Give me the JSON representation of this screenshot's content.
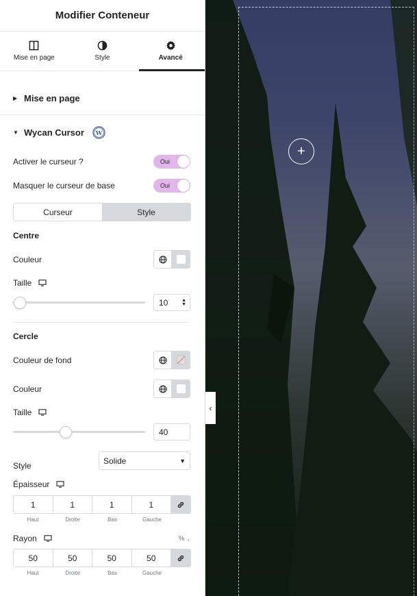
{
  "header": {
    "title": "Modifier Conteneur"
  },
  "tabs": [
    {
      "label": "Mise en page",
      "icon": "layout-columns-icon"
    },
    {
      "label": "Style",
      "icon": "half-circle-icon"
    },
    {
      "label": "Avancé",
      "icon": "gear-icon",
      "active": true
    }
  ],
  "sections": {
    "layout": {
      "title": "Mise en page",
      "expanded": false
    },
    "cursor": {
      "title": "Wycan Cursor",
      "expanded": true,
      "logo": "wordpress-icon"
    }
  },
  "cursor": {
    "activate": {
      "label": "Activer le curseur ?",
      "value": "Oui"
    },
    "hide_base": {
      "label": "Masquer le curseur de base",
      "value": "Oui"
    },
    "switcher": {
      "left": "Curseur",
      "right": "Style",
      "selected": "Style"
    },
    "centre": {
      "heading": "Centre",
      "color_label": "Couleur",
      "size_label": "Taille",
      "size_value": "10",
      "size_fraction": 0.05
    },
    "cercle": {
      "heading": "Cercle",
      "bg_color_label": "Couleur de fond",
      "color_label": "Couleur",
      "size_label": "Taille",
      "size_value": "40",
      "size_fraction": 0.4,
      "style_label": "Style",
      "style_value": "Solide",
      "thickness_label": "Épaisseur",
      "thickness": {
        "top": "1",
        "right": "1",
        "bottom": "1",
        "left": "1"
      },
      "radius_label": "Rayon",
      "radius_unit": "%",
      "radius": {
        "top": "50",
        "right": "50",
        "bottom": "50",
        "left": "50"
      },
      "dim_labels": {
        "top": "Haut",
        "right": "Droite",
        "bottom": "Bas",
        "left": "Gauche"
      }
    }
  },
  "preview": {
    "add_button": "+"
  },
  "colors": {
    "toggle_on": "#e2b6ea",
    "selected_segment": "#d5d8dc"
  }
}
